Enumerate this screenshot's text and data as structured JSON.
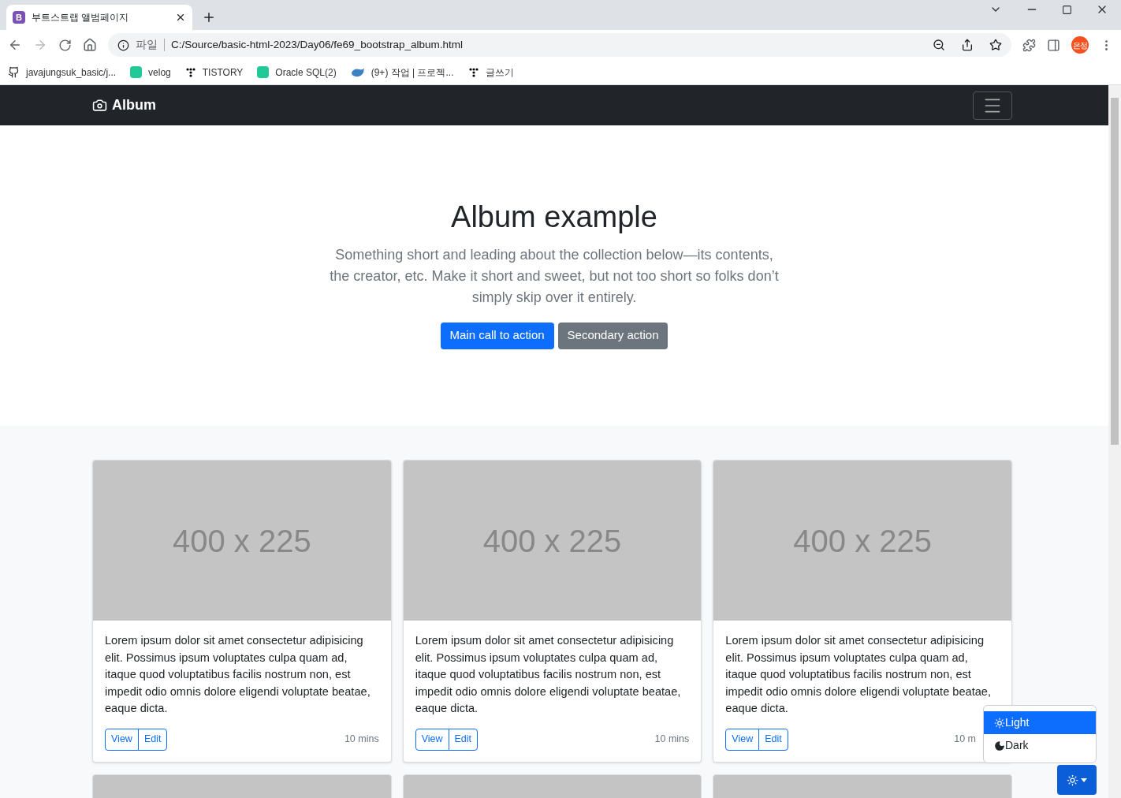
{
  "browser": {
    "tab_title": "부트스트랩 앨범페이지",
    "tab_icon_letter": "B",
    "url_scheme": "파일",
    "url": "C:/Source/basic-html-2023/Day06/fe69_bootstrap_album.html",
    "profile": "은정",
    "bookmarks": [
      {
        "label": "javajungsuk_basic/j...",
        "kind": "github"
      },
      {
        "label": "velog",
        "kind": "velog"
      },
      {
        "label": "TISTORY",
        "kind": "dots"
      },
      {
        "label": "Oracle SQL(2)",
        "kind": "velog"
      },
      {
        "label": "(9+) 작업 | 프로젝...",
        "kind": "whale"
      },
      {
        "label": "글쓰기",
        "kind": "dots"
      }
    ]
  },
  "navbar": {
    "brand": "Album"
  },
  "hero": {
    "title": "Album example",
    "lead": "Something short and leading about the collection below—its contents, the creator, etc. Make it short and sweet, but not too short so folks don’t simply skip over it entirely.",
    "primary_button": "Main call to action",
    "secondary_button": "Secondary action"
  },
  "cards": [
    {
      "thumbnail": "400 x 225",
      "text": "Lorem ipsum dolor sit amet consectetur adipisicing elit. Possimus ipsum voluptates culpa quam ad, itaque quod voluptatibus facilis nostrum non, est impedit odio omnis dolore eligendi voluptate beatae, eaque dicta.",
      "buttons": [
        "View",
        "Edit"
      ],
      "time": "10 mins"
    },
    {
      "thumbnail": "400 x 225",
      "text": "Lorem ipsum dolor sit amet consectetur adipisicing elit. Possimus ipsum voluptates culpa quam ad, itaque quod voluptatibus facilis nostrum non, est impedit odio omnis dolore eligendi voluptate beatae, eaque dicta.",
      "buttons": [
        "View",
        "Edit"
      ],
      "time": "10 mins"
    },
    {
      "thumbnail": "400 x 225",
      "text": "Lorem ipsum dolor sit amet consectetur adipisicing elit. Possimus ipsum voluptates culpa quam ad, itaque quod voluptatibus facilis nostrum non, est impedit odio omnis dolore eligendi voluptate beatae, eaque dicta.",
      "buttons": [
        "View",
        "Edit"
      ],
      "time": "10 m"
    }
  ],
  "theme_menu": {
    "options": [
      {
        "label": "Light",
        "kind": "sun",
        "selected": true
      },
      {
        "label": "Dark",
        "kind": "moon",
        "selected": false
      }
    ]
  }
}
